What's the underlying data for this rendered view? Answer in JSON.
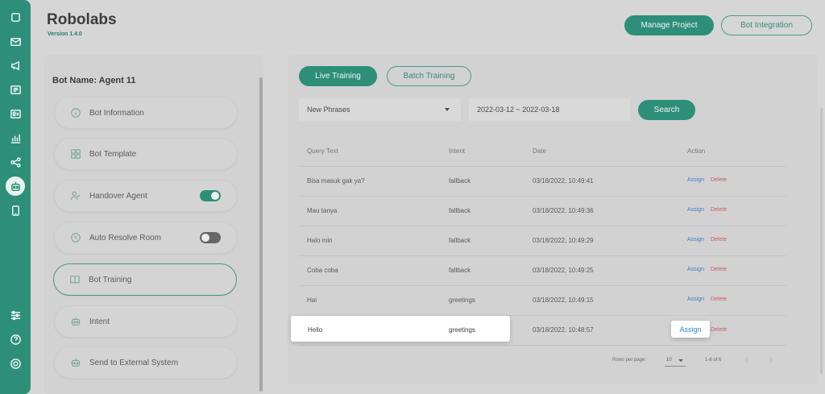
{
  "app": {
    "title": "Robolabs",
    "version": "Version 1.4.0"
  },
  "header": {
    "manage_project": "Manage Project",
    "bot_integration": "Bot Integration"
  },
  "rail": {
    "icons": [
      "square-icon",
      "mail-icon",
      "megaphone-icon",
      "contact-card-icon",
      "id-card-icon",
      "analytics-icon",
      "share-icon",
      "bot-icon",
      "mobile-icon",
      "settings-sliders-icon",
      "help-icon",
      "power-icon"
    ],
    "active": "bot-icon"
  },
  "bot": {
    "name_label": "Bot Name: Agent 11",
    "menu": [
      {
        "label": "Bot Information",
        "icon": "info-icon"
      },
      {
        "label": "Bot Template",
        "icon": "grid-icon"
      },
      {
        "label": "Handover Agent",
        "icon": "user-check-icon",
        "toggle": "on"
      },
      {
        "label": "Auto Resolve Room",
        "icon": "auto-resolve-icon",
        "toggle": "off"
      },
      {
        "label": "Bot Training",
        "icon": "book-icon",
        "active": true
      },
      {
        "label": "Intent",
        "icon": "robot-icon"
      },
      {
        "label": "Send to External System",
        "icon": "robot-icon"
      }
    ]
  },
  "training": {
    "tabs": [
      "Live Training",
      "Batch Training"
    ],
    "active_tab": "Live Training",
    "filter": {
      "type_value": "New Phrases",
      "date_range": "2022-03-12 ~ 2022-03-18",
      "search_label": "Search"
    },
    "columns": [
      "Query Text",
      "Intent",
      "Date",
      "Action"
    ],
    "rows": [
      {
        "query": "Bisa masuk gak ya?",
        "intent": "fallback",
        "date": "03/18/2022, 10:49:41",
        "assign": "Assign",
        "delete": "Delete"
      },
      {
        "query": "Mau tanya",
        "intent": "fallback",
        "date": "03/18/2022, 10:49:36",
        "assign": "Assign",
        "delete": "Delete"
      },
      {
        "query": "Halo min",
        "intent": "fallback",
        "date": "03/18/2022, 10:49:29",
        "assign": "Assign",
        "delete": "Delete"
      },
      {
        "query": "Coba coba",
        "intent": "fallback",
        "date": "03/18/2022, 10:49:25",
        "assign": "Assign",
        "delete": "Delete"
      },
      {
        "query": "Hai",
        "intent": "greetings",
        "date": "03/18/2022, 10:49:15",
        "assign": "Assign",
        "delete": "Delete"
      },
      {
        "query": "Hello",
        "intent": "greetings",
        "date": "03/18/2022, 10:48:57",
        "assign": "Assign",
        "delete": "Delete"
      }
    ],
    "pagination": {
      "rows_label": "Rows per page:",
      "rows_value": "10",
      "range": "1-6 of 6",
      "prev": "‹",
      "next": "›"
    }
  },
  "colors": {
    "brand": "#2e8f78",
    "assign": "#3f7fc4",
    "delete": "#c85a6a"
  }
}
